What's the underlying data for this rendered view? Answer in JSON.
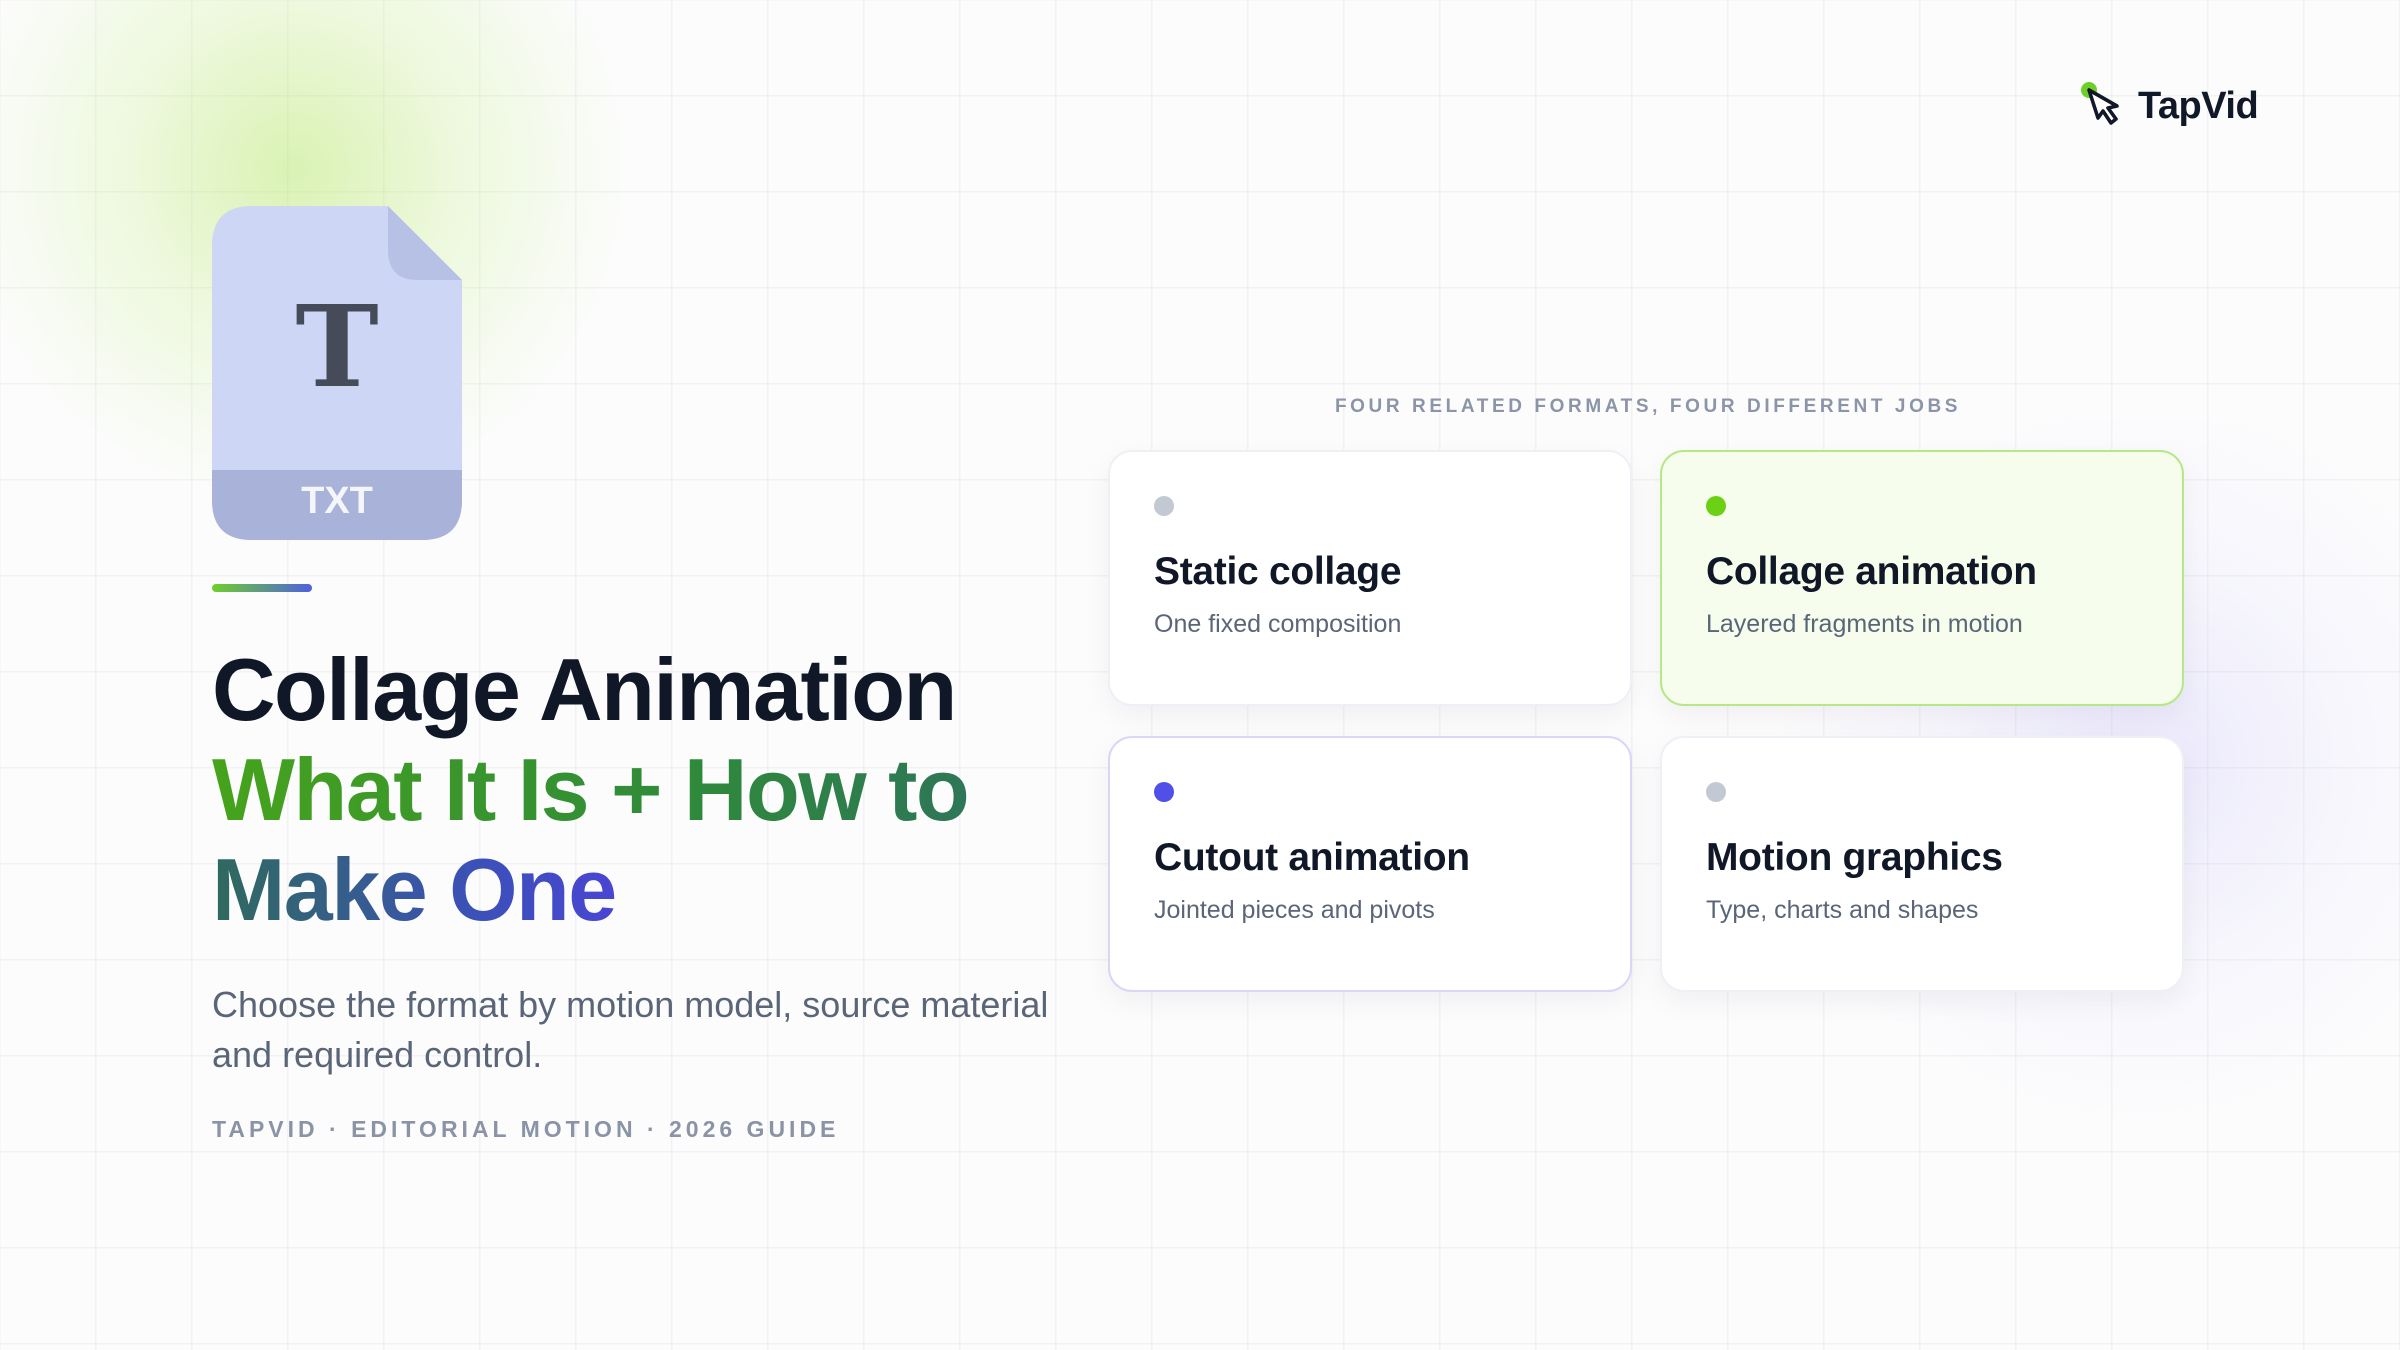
{
  "brand": {
    "name": "TapVid",
    "icon": "pointer-hand-icon",
    "colors": {
      "green": "#6fcf2a",
      "indigo": "#4f5fe0"
    }
  },
  "file_icon": {
    "glyph": "T",
    "extension": "TXT"
  },
  "hero": {
    "title_line1": "Collage Animation",
    "title_line2": "What It Is + How to",
    "title_line3": "Make One",
    "subtitle": "Choose the format by motion model, source material and required control.",
    "byline": "TAPVID · EDITORIAL MOTION · 2026 GUIDE"
  },
  "formats": {
    "label": "FOUR RELATED FORMATS, FOUR DIFFERENT JOBS",
    "cards": [
      {
        "title": "Static collage",
        "description": "One fixed composition",
        "dot_color": "#c3c9d3",
        "highlighted": false
      },
      {
        "title": "Collage animation",
        "description": "Layered fragments in motion",
        "dot_color": "#6cd115",
        "highlighted": true
      },
      {
        "title": "Cutout animation",
        "description": "Jointed pieces and pivots",
        "dot_color": "#5050e8",
        "highlighted": false
      },
      {
        "title": "Motion graphics",
        "description": "Type, charts and shapes",
        "dot_color": "#c3c9d3",
        "highlighted": false
      }
    ]
  }
}
